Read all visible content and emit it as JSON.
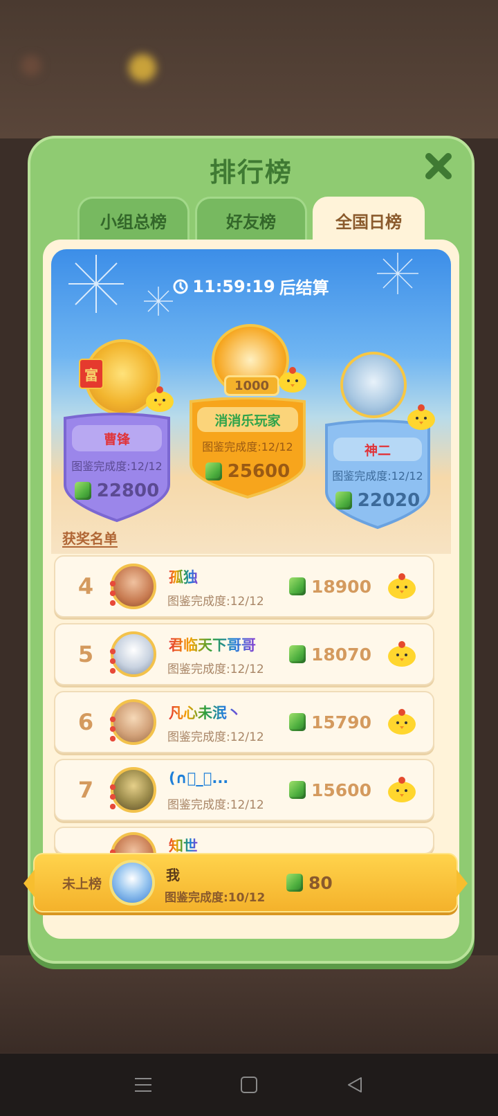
{
  "title": "排行榜",
  "tabs": [
    {
      "label": "小组总榜",
      "active": false
    },
    {
      "label": "好友榜",
      "active": false
    },
    {
      "label": "全国日榜",
      "active": true
    }
  ],
  "timer": {
    "time": "11:59:19",
    "suffix": "后结算"
  },
  "podium": {
    "first": {
      "name": "消消乐玩家",
      "progress": "图鉴完成度:12/12",
      "score": "25600",
      "badge": "1000"
    },
    "second": {
      "name": "曹锋",
      "progress": "图鉴完成度:12/12",
      "score": "22800",
      "badge_char": "富"
    },
    "third": {
      "name": "神二",
      "progress": "图鉴完成度:12/12",
      "score": "22020"
    }
  },
  "winners_label": "获奖名单",
  "rows": [
    {
      "rank": "4",
      "name": "孤独",
      "progress": "图鉴完成度:12/12",
      "score": "18900"
    },
    {
      "rank": "5",
      "name": "君临天下哥哥",
      "progress": "图鉴完成度:12/12",
      "score": "18070"
    },
    {
      "rank": "6",
      "name": "凡心未泯丶",
      "progress": "图鉴完成度:12/12",
      "score": "15790"
    },
    {
      "rank": "7",
      "name": "(∩᳚_᳚...",
      "progress": "图鉴完成度:12/12",
      "score": "15600"
    },
    {
      "rank": "",
      "name": "知世",
      "progress": "",
      "score": ""
    }
  ],
  "me": {
    "rank_text": "未上榜",
    "name": "我",
    "progress": "图鉴完成度:10/12",
    "score": "80"
  },
  "colors": {
    "panel": "#8fcb72",
    "accent": "#f4b22b",
    "rank": "#d49a5e"
  }
}
